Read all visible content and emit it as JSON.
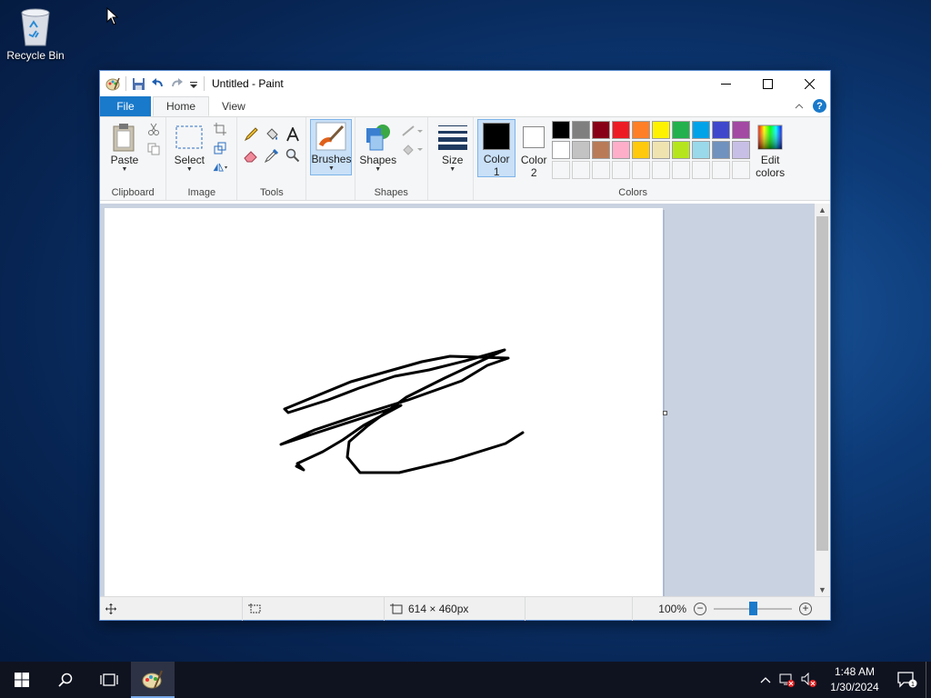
{
  "desktop": {
    "recycle_bin_label": "Recycle Bin"
  },
  "window": {
    "title": "Untitled - Paint",
    "tabs": {
      "file": "File",
      "home": "Home",
      "view": "View"
    },
    "ribbon": {
      "clipboard": {
        "paste": "Paste",
        "label": "Clipboard"
      },
      "image": {
        "select": "Select",
        "label": "Image"
      },
      "tools": {
        "label": "Tools"
      },
      "brushes": "Brushes",
      "shapes": {
        "shapes": "Shapes",
        "label": "Shapes"
      },
      "size": "Size",
      "color1_line1": "Color",
      "color1_line2": "1",
      "color2_line1": "Color",
      "color2_line2": "2",
      "edit_colors_line1": "Edit",
      "edit_colors_line2": "colors",
      "colors_label": "Colors"
    },
    "palette": [
      "#000000",
      "#7f7f7f",
      "#880015",
      "#ed1c24",
      "#ff7f27",
      "#fff200",
      "#22b14c",
      "#00a2e8",
      "#3f48cc",
      "#a349a4",
      "#ffffff",
      "#c3c3c3",
      "#b97a57",
      "#ffaec9",
      "#ffc90e",
      "#efe4b0",
      "#b5e61d",
      "#99d9ea",
      "#7092be",
      "#c8bfe7"
    ],
    "status": {
      "canvas_size": "614 × 460px",
      "zoom": "100%"
    }
  },
  "taskbar": {
    "time": "1:48 AM",
    "date": "1/30/2024"
  }
}
